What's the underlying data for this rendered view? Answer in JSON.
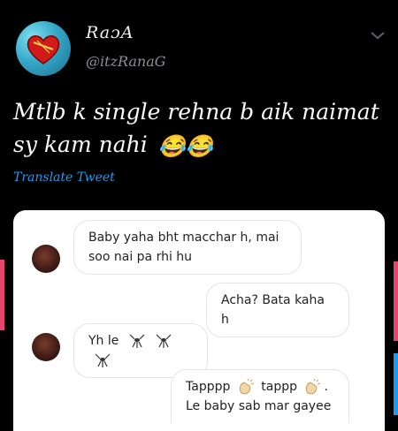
{
  "tweet": {
    "author_name": "RaɔA",
    "author_handle": "@itzRanaG",
    "text": "Mtlb k single rehna b aik naimat sy kam nahi",
    "emoji": "😂😂",
    "translate_label": "Translate Tweet"
  },
  "chat": {
    "messages": [
      {
        "side": "incoming",
        "text": "Baby yaha bht macchar h, mai soo nai pa rhi hu"
      },
      {
        "side": "outgoing",
        "text": "Acha? Bata kaha h"
      },
      {
        "side": "incoming",
        "text": "Yh le",
        "icons": [
          "mosquito-icon",
          "mosquito-icon",
          "mosquito-icon"
        ]
      },
      {
        "side": "outgoing",
        "text_line1_a": "Tapppp",
        "text_line1_b": "tappp",
        "text_line1_c": ".",
        "text_line2": "Le baby sab mar gayee",
        "icons": [
          "clap-icon",
          "clap-icon"
        ]
      }
    ]
  },
  "colors": {
    "background": "#000000",
    "link": "#1d9bf0",
    "card": "#ffffff",
    "edge_accent": "#e8456e"
  }
}
